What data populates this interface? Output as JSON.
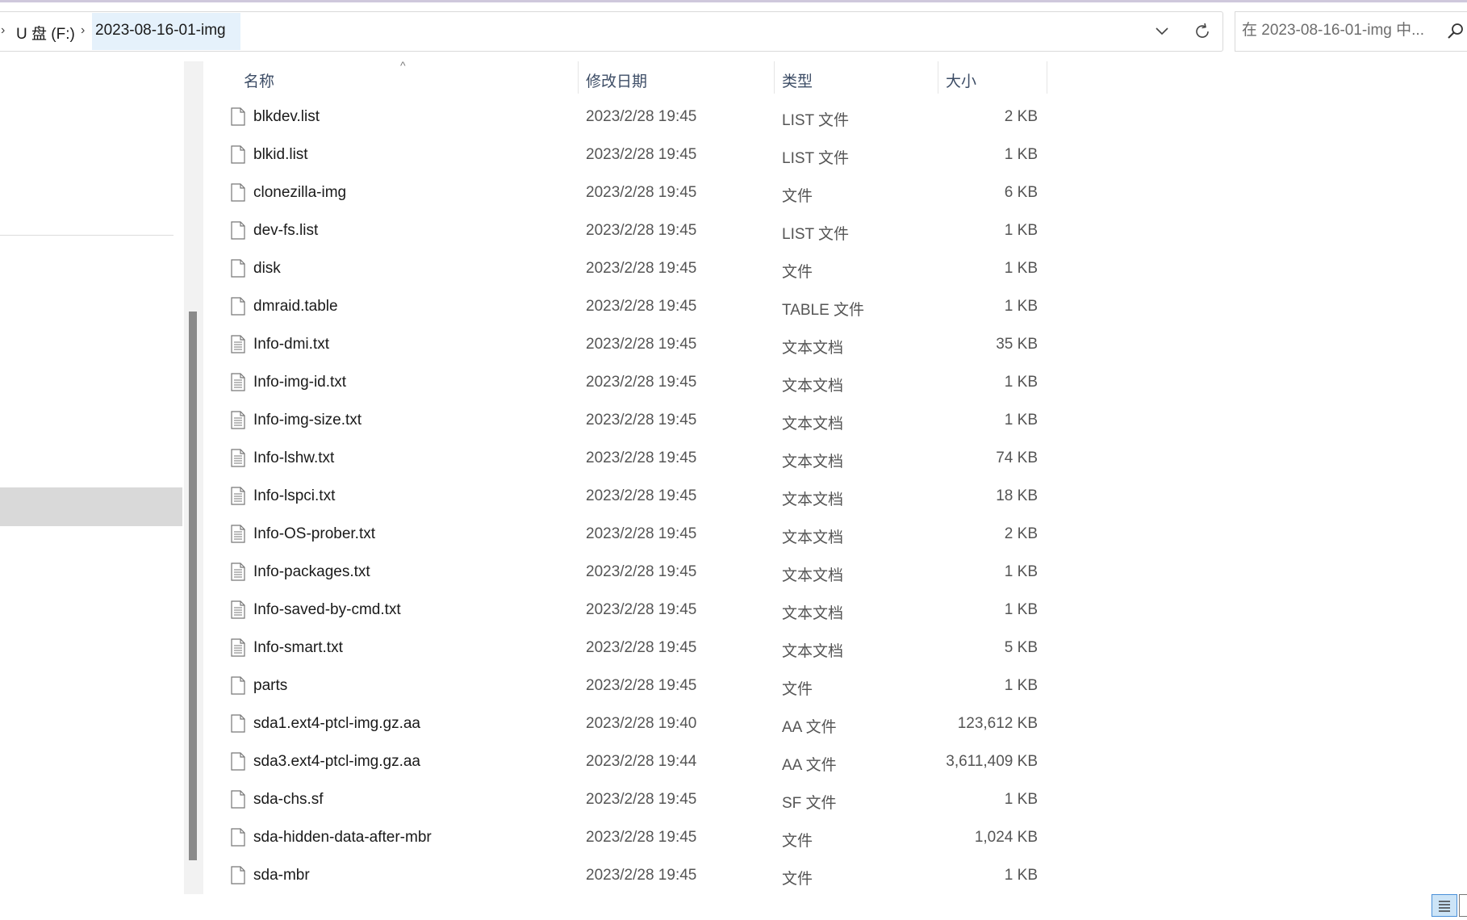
{
  "breadcrumb": {
    "drive": "U 盘 (F:)",
    "folder": "2023-08-16-01-img"
  },
  "search": {
    "placeholder": "在 2023-08-16-01-img 中..."
  },
  "columns": {
    "name": "名称",
    "date": "修改日期",
    "type": "类型",
    "size": "大小"
  },
  "files": [
    {
      "name": "blkdev.list",
      "date": "2023/2/28 19:45",
      "type": "LIST 文件",
      "size": "2 KB",
      "icon": "file-icon"
    },
    {
      "name": "blkid.list",
      "date": "2023/2/28 19:45",
      "type": "LIST 文件",
      "size": "1 KB",
      "icon": "file-icon"
    },
    {
      "name": "clonezilla-img",
      "date": "2023/2/28 19:45",
      "type": "文件",
      "size": "6 KB",
      "icon": "file-icon"
    },
    {
      "name": "dev-fs.list",
      "date": "2023/2/28 19:45",
      "type": "LIST 文件",
      "size": "1 KB",
      "icon": "file-icon"
    },
    {
      "name": "disk",
      "date": "2023/2/28 19:45",
      "type": "文件",
      "size": "1 KB",
      "icon": "file-icon"
    },
    {
      "name": "dmraid.table",
      "date": "2023/2/28 19:45",
      "type": "TABLE 文件",
      "size": "1 KB",
      "icon": "file-icon"
    },
    {
      "name": "Info-dmi.txt",
      "date": "2023/2/28 19:45",
      "type": "文本文档",
      "size": "35 KB",
      "icon": "text-file-icon"
    },
    {
      "name": "Info-img-id.txt",
      "date": "2023/2/28 19:45",
      "type": "文本文档",
      "size": "1 KB",
      "icon": "text-file-icon"
    },
    {
      "name": "Info-img-size.txt",
      "date": "2023/2/28 19:45",
      "type": "文本文档",
      "size": "1 KB",
      "icon": "text-file-icon"
    },
    {
      "name": "Info-lshw.txt",
      "date": "2023/2/28 19:45",
      "type": "文本文档",
      "size": "74 KB",
      "icon": "text-file-icon"
    },
    {
      "name": "Info-lspci.txt",
      "date": "2023/2/28 19:45",
      "type": "文本文档",
      "size": "18 KB",
      "icon": "text-file-icon"
    },
    {
      "name": "Info-OS-prober.txt",
      "date": "2023/2/28 19:45",
      "type": "文本文档",
      "size": "2 KB",
      "icon": "text-file-icon"
    },
    {
      "name": "Info-packages.txt",
      "date": "2023/2/28 19:45",
      "type": "文本文档",
      "size": "1 KB",
      "icon": "text-file-icon"
    },
    {
      "name": "Info-saved-by-cmd.txt",
      "date": "2023/2/28 19:45",
      "type": "文本文档",
      "size": "1 KB",
      "icon": "text-file-icon"
    },
    {
      "name": "Info-smart.txt",
      "date": "2023/2/28 19:45",
      "type": "文本文档",
      "size": "5 KB",
      "icon": "text-file-icon"
    },
    {
      "name": "parts",
      "date": "2023/2/28 19:45",
      "type": "文件",
      "size": "1 KB",
      "icon": "file-icon"
    },
    {
      "name": "sda1.ext4-ptcl-img.gz.aa",
      "date": "2023/2/28 19:40",
      "type": "AA 文件",
      "size": "123,612 KB",
      "icon": "file-icon"
    },
    {
      "name": "sda3.ext4-ptcl-img.gz.aa",
      "date": "2023/2/28 19:44",
      "type": "AA 文件",
      "size": "3,611,409 KB",
      "icon": "file-icon"
    },
    {
      "name": "sda-chs.sf",
      "date": "2023/2/28 19:45",
      "type": "SF 文件",
      "size": "1 KB",
      "icon": "file-icon"
    },
    {
      "name": "sda-hidden-data-after-mbr",
      "date": "2023/2/28 19:45",
      "type": "文件",
      "size": "1,024 KB",
      "icon": "file-icon"
    },
    {
      "name": "sda-mbr",
      "date": "2023/2/28 19:45",
      "type": "文件",
      "size": "1 KB",
      "icon": "file-icon"
    }
  ],
  "colors": {
    "selection": "#e5f1fb",
    "nav_selected": "#d9d9d9",
    "header_text": "#3d4d66",
    "scroll_thumb": "#8a8a8a"
  }
}
